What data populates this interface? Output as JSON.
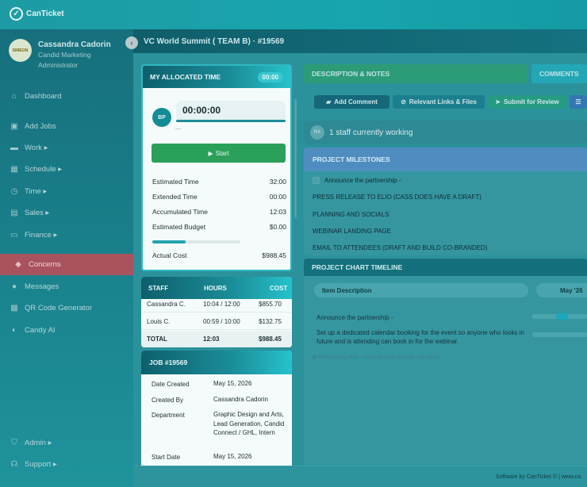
{
  "app": {
    "name": "CanTicket"
  },
  "profile": {
    "avatar_text": "SIMEON",
    "name": "Cassandra Cadorin",
    "role_line1": "Candid Marketing",
    "role_line2": "Administrator",
    "collapse_icon": "chevron-left-icon"
  },
  "nav": {
    "dashboard": "Dashboard",
    "add_jobs": "Add Jobs",
    "work": "Work",
    "schedule": "Schedule",
    "time": "Time",
    "sales": "Sales",
    "finance": "Finance",
    "concerns": "Concerns",
    "messages": "Messages",
    "qr": "QR Code Generator",
    "candy": "Candy AI",
    "admin": "Admin",
    "support": "Support"
  },
  "header": {
    "title": "VC World Summit ( TEAM B) · #19569"
  },
  "timer": {
    "heading": "MY ALLOCATED TIME",
    "badge": "00:00",
    "initials": "BP",
    "value": "00:00:00",
    "dash": "—",
    "start_label": "Start",
    "rows": [
      {
        "label": "Estimated Time",
        "value": "32:00"
      },
      {
        "label": "Extended Time",
        "value": "00:00"
      },
      {
        "label": "Accumulated Time",
        "value": "12:03"
      },
      {
        "label": "Estimated Budget",
        "value": "$0.00"
      }
    ],
    "budget_progress": 0.38,
    "actual_label": "Actual Cost",
    "actual_value": "$988.45"
  },
  "staff": {
    "headers": [
      "STAFF",
      "HOURS",
      "COST"
    ],
    "rows": [
      {
        "name": "Cassandra C.",
        "hours": "10:04 / 12:00",
        "cost": "$855.70"
      },
      {
        "name": "Louis C.",
        "hours": "00:59 / 10:00",
        "cost": "$132.75"
      }
    ],
    "total": {
      "name": "TOTAL",
      "hours": "12:03",
      "cost": "$988.45"
    }
  },
  "job": {
    "heading": "JOB #19569",
    "date_created_label": "Date Created",
    "date_created": "May 15, 2026",
    "created_by_label": "Created By",
    "created_by": "Cassandra Cadorin",
    "department_label": "Department",
    "department": "Graphic Design and Arts, Lead Generation, Candid Connect / GHL, Intern",
    "start_date_label": "Start Date",
    "start_date": "May 15, 2026"
  },
  "tabs": {
    "description": "DESCRIPTION & NOTES",
    "comments": "COMMENTS"
  },
  "actions": {
    "add_comment": "Add Comment",
    "links": "Relevant Links & Files",
    "submit": "Submit for Review"
  },
  "working": {
    "initials": "RA",
    "text": "1 staff currently working"
  },
  "milestones": {
    "heading": "PROJECT MILESTONES",
    "items": [
      "Announce the partnership -",
      "PRESS RELEASE TO ELIO (CASS DOES HAVE A DRAFT)",
      "PLANNING AND SOCIALS",
      "WEBINAR LANDING PAGE",
      "EMAIL TO ATTENDEES (DRAFT AND BUILD CO-BRANDED)"
    ]
  },
  "timeline": {
    "heading": "PROJECT CHART TIMELINE",
    "col_item": "Item Description",
    "col_month": "May '26",
    "item1": "Announce the partnership -",
    "item2": "Set up a dedicated calendar booking for the event so anyone who looks in future and is attending can book in for the webinar.",
    "window": "Window: May 2026 – Oct 2026 (from checklist / job dates)"
  },
  "footer": {
    "text": "Software by CanTicket © | www.ca"
  },
  "colors": {
    "accent": "#1e9ba4",
    "active_nav": "#a9535e",
    "start_green": "#2aa05a",
    "milestones_head": "#4f8dc0"
  }
}
